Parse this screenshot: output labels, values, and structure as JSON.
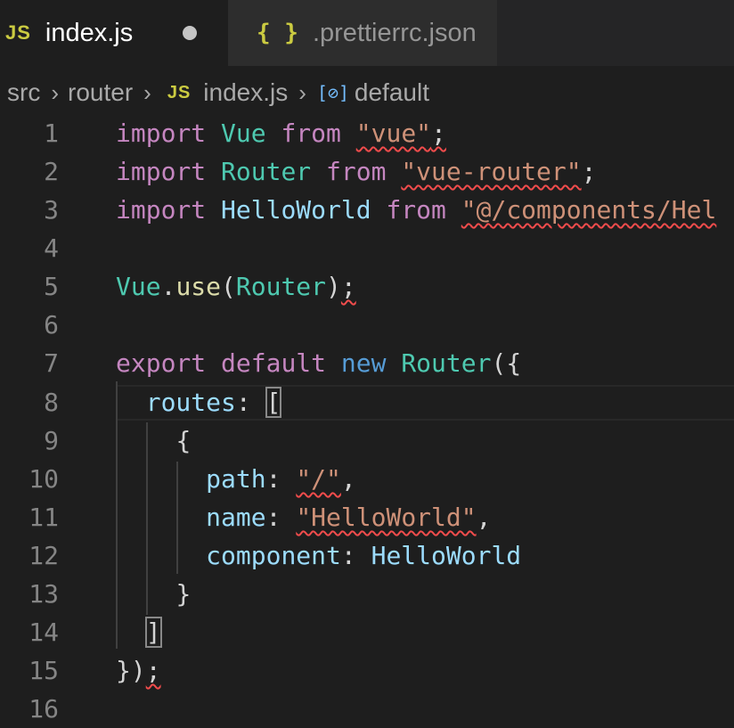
{
  "tabs": [
    {
      "icon": "JS",
      "label": "index.js",
      "active": true,
      "dirty": true
    },
    {
      "icon": "{ }",
      "label": ".prettierrc.json",
      "active": false,
      "dirty": false
    }
  ],
  "breadcrumb": {
    "src": "src",
    "router": "router",
    "file_icon": "JS",
    "file": "index.js",
    "symbol_icon": "[⊘]",
    "symbol": "default"
  },
  "line_numbers": [
    "1",
    "2",
    "3",
    "4",
    "5",
    "6",
    "7",
    "8",
    "9",
    "10",
    "11",
    "12",
    "13",
    "14",
    "15",
    "16"
  ],
  "code": {
    "l1": {
      "kw": "import",
      "name": "Vue",
      "from": "from",
      "str": "\"vue\"",
      "end": ";"
    },
    "l2": {
      "kw": "import",
      "name": "Router",
      "from": "from",
      "str": "\"vue-router\"",
      "end": ";"
    },
    "l3": {
      "kw": "import",
      "name": "HelloWorld",
      "from": "from",
      "str": "\"@/components/Hel"
    },
    "l5": {
      "obj": "Vue",
      "dot": ".",
      "fn": "use",
      "open": "(",
      "arg": "Router",
      "close": ")",
      "end": ";"
    },
    "l7": {
      "export": "export",
      "default": "default",
      "new": "new",
      "cls": "Router",
      "open": "({"
    },
    "l8": {
      "key": "routes",
      "colon": ": ",
      "bracket": "["
    },
    "l9": {
      "brace": "{"
    },
    "l10": {
      "key": "path",
      "colon": ": ",
      "str": "\"/\"",
      "comma": ","
    },
    "l11": {
      "key": "name",
      "colon": ": ",
      "str": "\"HelloWorld\"",
      "comma": ","
    },
    "l12": {
      "key": "component",
      "colon": ": ",
      "val": "HelloWorld"
    },
    "l13": {
      "brace": "}"
    },
    "l14": {
      "bracket": "]"
    },
    "l15": {
      "close": "})",
      "end": ";"
    }
  },
  "colors": {
    "keyword": "#c586c0",
    "storage": "#569cd6",
    "type": "#4ec9b0",
    "variable": "#9cdcfe",
    "function": "#dcdcaa",
    "string": "#ce9178",
    "error_squiggle": "#f14c4c"
  }
}
